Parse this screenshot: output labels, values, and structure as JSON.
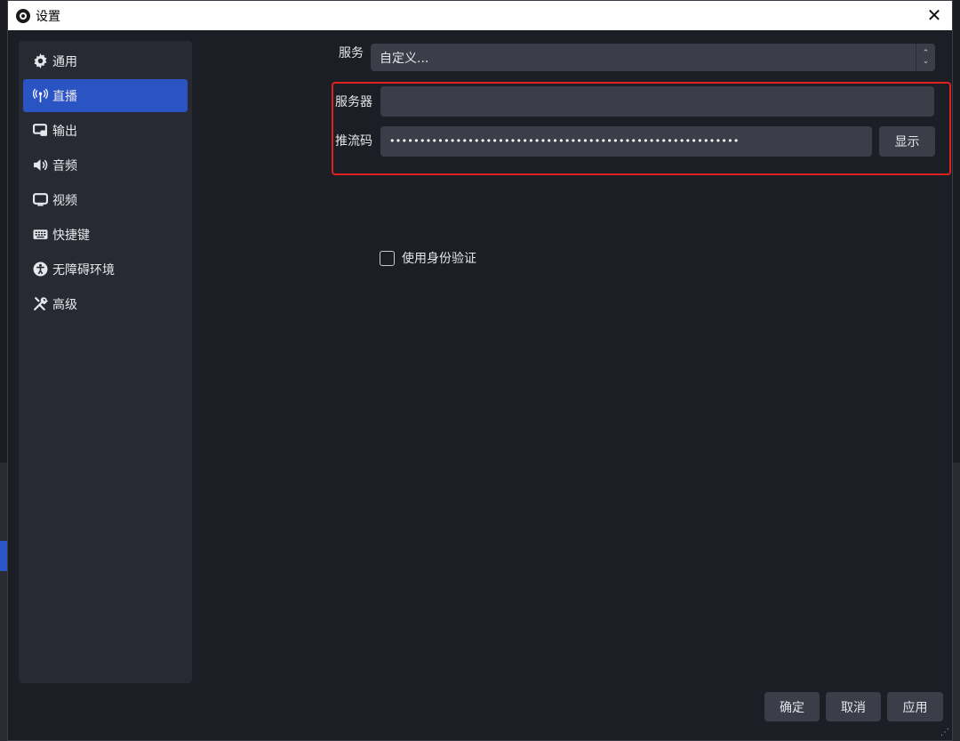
{
  "window": {
    "title": "设置",
    "close_glyph": "✕"
  },
  "sidebar": {
    "items": [
      {
        "label": "通用",
        "icon": "gear-icon"
      },
      {
        "label": "直播",
        "icon": "antenna-icon",
        "active": true
      },
      {
        "label": "输出",
        "icon": "output-icon"
      },
      {
        "label": "音频",
        "icon": "speaker-icon"
      },
      {
        "label": "视频",
        "icon": "monitor-icon"
      },
      {
        "label": "快捷键",
        "icon": "keyboard-icon"
      },
      {
        "label": "无障碍环境",
        "icon": "accessibility-icon"
      },
      {
        "label": "高级",
        "icon": "tools-icon"
      }
    ]
  },
  "stream": {
    "service_label": "服务",
    "service_value": "自定义...",
    "server_label": "服务器",
    "server_value": "",
    "key_label": "推流码",
    "key_value": "••••••••••••••••••••••••••••••••••••••••••••••••••••••••••",
    "show_button": "显示",
    "auth_label": "使用身份验证",
    "auth_checked": false
  },
  "footer": {
    "ok": "确定",
    "cancel": "取消",
    "apply": "应用"
  },
  "colors": {
    "accent": "#2a53c3",
    "highlight_box": "#e01f1f",
    "field_bg": "#3b3e49"
  }
}
